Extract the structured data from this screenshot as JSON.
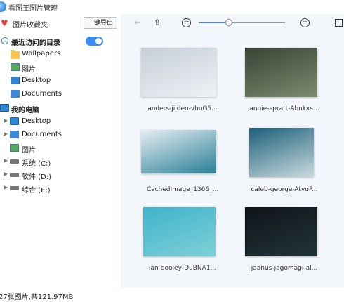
{
  "window": {
    "title": "看图王图片管理"
  },
  "sidebar": {
    "favorites_label": "图片收藏夹",
    "export_label": "一键导出",
    "recent_label": "最近访问的目录",
    "recent_toggle_on": true,
    "recent_items": [
      {
        "label": "Wallpapers",
        "icon": "folder-icon"
      },
      {
        "label": "图片",
        "icon": "picture-icon"
      },
      {
        "label": "Desktop",
        "icon": "monitor-icon"
      },
      {
        "label": "Documents",
        "icon": "documents-icon"
      }
    ],
    "computer_label": "我的电脑",
    "computer_items": [
      {
        "label": "Desktop",
        "icon": "monitor-icon"
      },
      {
        "label": "Documents",
        "icon": "documents-icon"
      },
      {
        "label": "图片",
        "icon": "picture-icon"
      },
      {
        "label": "系统 (C:)",
        "icon": "drive-icon"
      },
      {
        "label": "软件 (D:)",
        "icon": "drive-icon"
      },
      {
        "label": "综合 (E:)",
        "icon": "drive-icon"
      }
    ]
  },
  "toolbar": {
    "zoom_level": 0.35
  },
  "thumbnails": [
    {
      "caption": "anders-jilden-vhnG5...",
      "colors": [
        "#c7ced8",
        "#eef1f5"
      ]
    },
    {
      "caption": "annie-spratt-Abnkxs...",
      "colors": [
        "#394436",
        "#7b8b6f"
      ]
    },
    {
      "caption": "CachedImage_1366_...",
      "colors": [
        "#e6edf2",
        "#2a7f97"
      ]
    },
    {
      "caption": "caleb-george-AtvuP...",
      "colors": [
        "#1c5f7a",
        "#c9d9de"
      ]
    },
    {
      "caption": "ian-dooley-DuBNA1...",
      "colors": [
        "#3eb3cc",
        "#7fd0d6"
      ]
    },
    {
      "caption": "jaanus-jagomagi-al...",
      "colors": [
        "#0f1418",
        "#22343b"
      ]
    }
  ],
  "status": {
    "summary": "27张图片,共121.97MB"
  }
}
